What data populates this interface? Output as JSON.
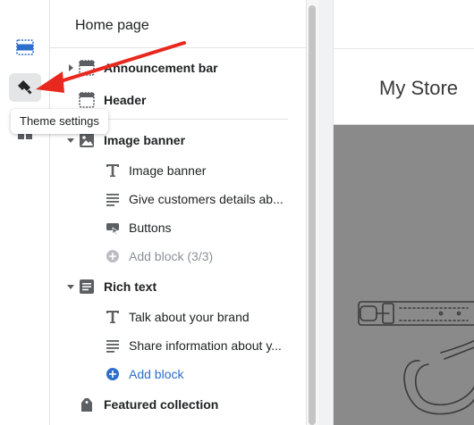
{
  "tooltip": "Theme settings",
  "panel": {
    "title": "Home page",
    "rows": [
      {
        "label": "Announcement bar"
      },
      {
        "label": "Header"
      },
      {
        "label": "Image banner"
      },
      {
        "label": "Image banner"
      },
      {
        "label": "Give customers details ab..."
      },
      {
        "label": "Buttons"
      },
      {
        "label": "Add block (3/3)"
      },
      {
        "label": "Rich text"
      },
      {
        "label": "Talk about your brand"
      },
      {
        "label": "Share information about y..."
      },
      {
        "label": "Add block"
      },
      {
        "label": "Featured collection"
      }
    ]
  },
  "preview": {
    "store_name": "My Store"
  },
  "colors": {
    "accent": "#2c6ecb",
    "arrow": "#e8281e",
    "banner": "#8a8a8a"
  },
  "icons": [
    "sections-icon",
    "paintbrush-icon",
    "apps-icon",
    "announcement-bar-icon",
    "header-icon",
    "image-icon",
    "text-icon",
    "paragraph-icon",
    "buttons-icon",
    "plus-circle-icon",
    "rich-text-icon",
    "tag-icon"
  ]
}
